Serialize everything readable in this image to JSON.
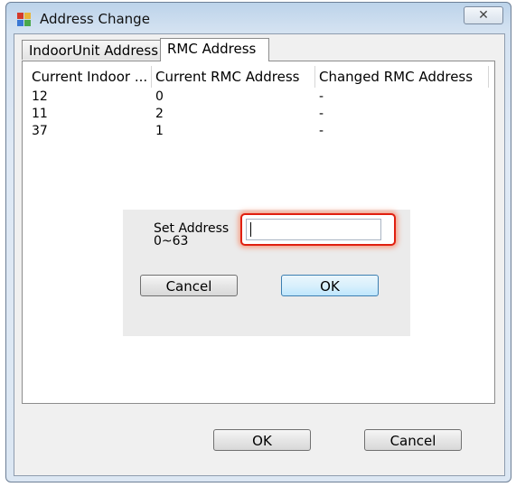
{
  "window": {
    "title": "Address Change",
    "close_glyph": "✕"
  },
  "tabs": [
    {
      "label": "IndoorUnit Address",
      "active": false
    },
    {
      "label": "RMC Address",
      "active": true
    }
  ],
  "list": {
    "columns": [
      "Current Indoor ...",
      "Current RMC Address",
      "Changed RMC Address"
    ],
    "rows": [
      [
        "12",
        "0",
        "-"
      ],
      [
        "11",
        "2",
        "-"
      ],
      [
        "37",
        "1",
        "-"
      ]
    ]
  },
  "set_address_dialog": {
    "label_line1": "Set Address",
    "label_line2": "0~63",
    "input_value": "",
    "cancel_label": "Cancel",
    "ok_label": "OK",
    "highlight_color": "#e02010"
  },
  "footer": {
    "ok_label": "OK",
    "cancel_label": "Cancel"
  },
  "icons": {
    "app": "app-window-icon",
    "close": "close-icon"
  }
}
